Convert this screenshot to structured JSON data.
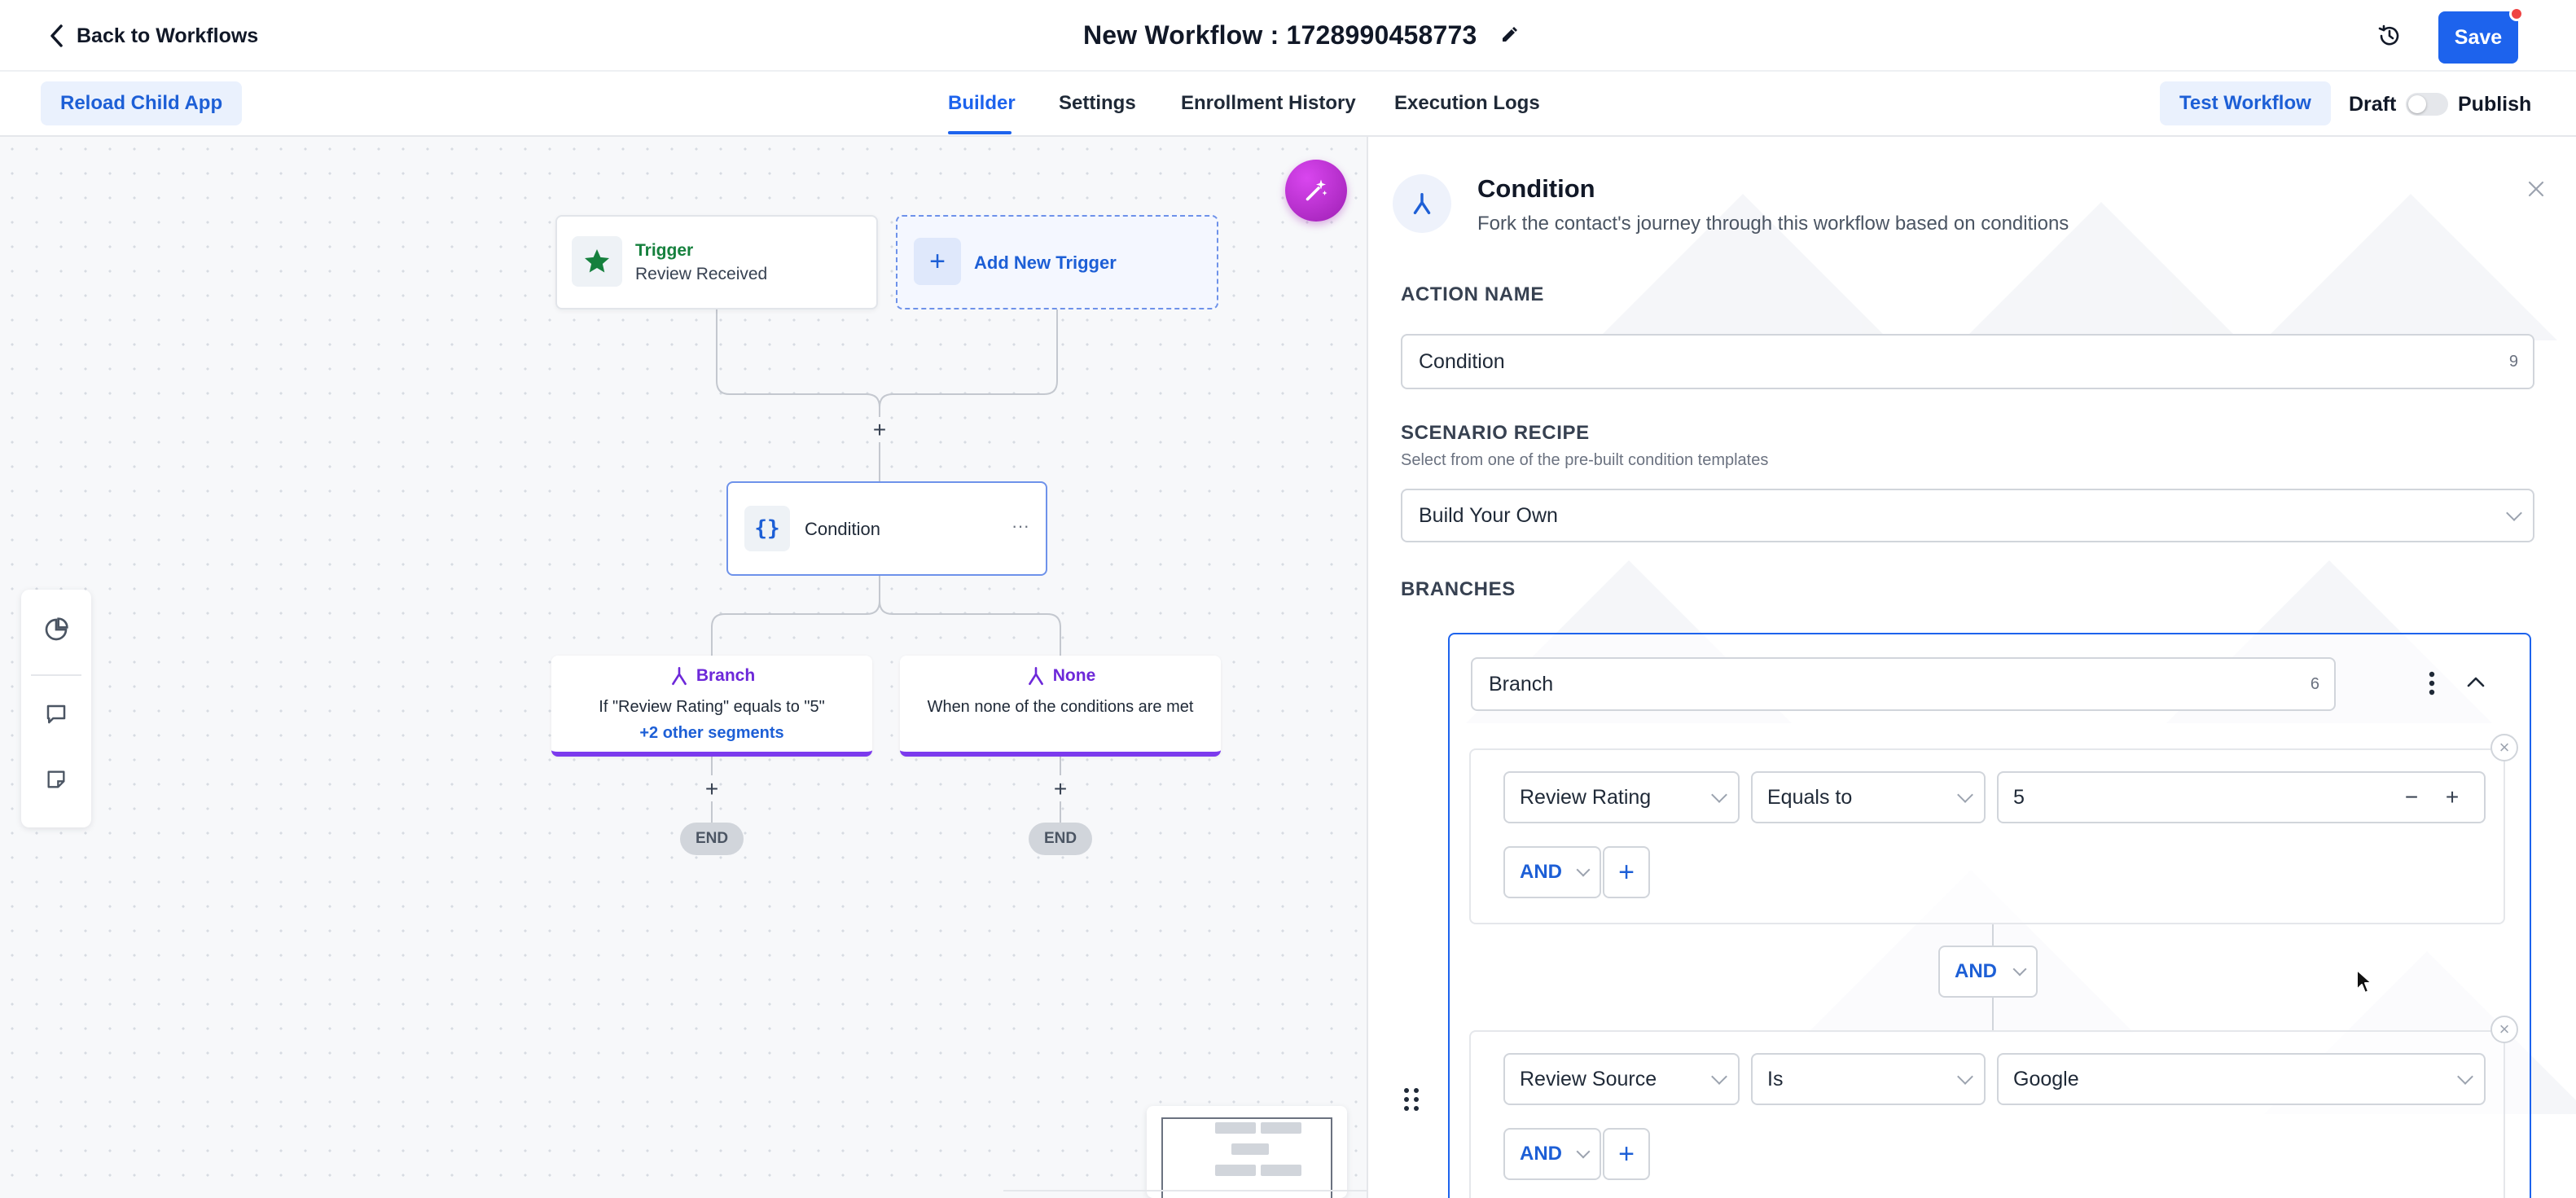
{
  "header": {
    "back_label": "Back to Workflows",
    "workflow_title": "New Workflow : 1728990458773",
    "save_label": "Save"
  },
  "subbar": {
    "reload_label": "Reload Child App",
    "tabs": [
      {
        "label": "Builder",
        "active": true
      },
      {
        "label": "Settings",
        "active": false
      },
      {
        "label": "Enrollment History",
        "active": false
      },
      {
        "label": "Execution Logs",
        "active": false
      }
    ],
    "test_label": "Test Workflow",
    "draft_label": "Draft",
    "publish_label": "Publish",
    "published": false
  },
  "canvas": {
    "trigger": {
      "kind": "Trigger",
      "name": "Review Received"
    },
    "add_trigger_label": "Add New Trigger",
    "condition_label": "Condition",
    "branches": [
      {
        "title": "Branch",
        "description": "If \"Review Rating\" equals to \"5\"",
        "link": "+2 other segments"
      },
      {
        "title": "None",
        "description": "When none of the conditions are met",
        "link": ""
      }
    ],
    "end_label": "END"
  },
  "panel": {
    "title": "Condition",
    "subtitle": "Fork the contact's journey through this workflow based on conditions",
    "action_name_label": "ACTION NAME",
    "action_name_value": "Condition",
    "action_name_count": "9",
    "scenario_label": "SCENARIO RECIPE",
    "scenario_help": "Select from one of the pre-built condition templates",
    "scenario_value": "Build Your Own",
    "branches_label": "BRANCHES",
    "branch": {
      "name": "Branch",
      "name_count": "6",
      "segments": [
        {
          "field": "Review Rating",
          "operator": "Equals to",
          "value": "5",
          "and_label": "AND"
        },
        {
          "field": "Review Source",
          "operator": "Is",
          "value": "Google",
          "and_label": "AND"
        }
      ],
      "segment_join": "AND"
    }
  },
  "colors": {
    "primary": "#1d63ed",
    "branch_accent": "#7c3aed",
    "trigger_green": "#15803d",
    "ai_fab": "#c026d3"
  }
}
